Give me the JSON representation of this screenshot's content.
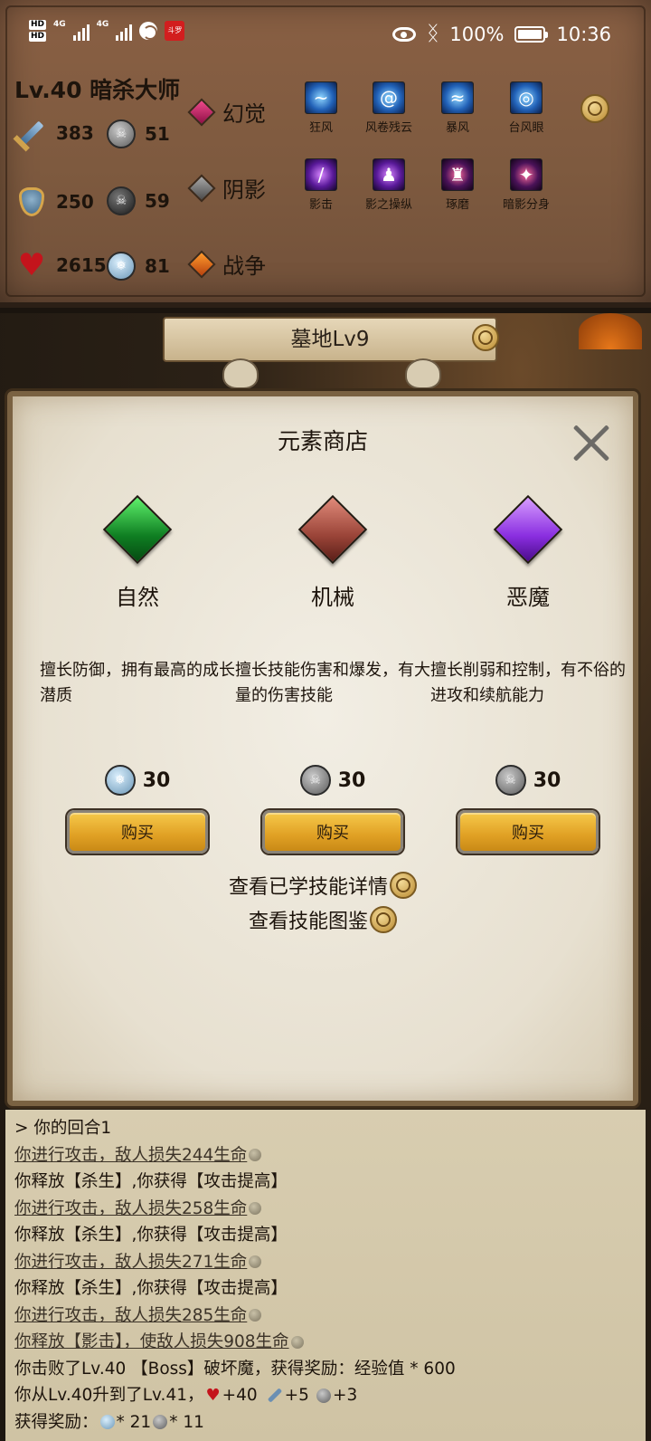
{
  "status_bar": {
    "hd1": "HD",
    "hd2": "HD",
    "net1": "4G",
    "net2": "4G",
    "app_badge": "斗罗",
    "battery": "100%",
    "time": "10:36"
  },
  "hero": {
    "title": "Lv.40 暗杀大师",
    "stats": {
      "attack": "383",
      "attack_sub": "51",
      "defense": "250",
      "defense_sub": "59",
      "hp": "2615",
      "hp_sub": "81"
    },
    "elements": [
      {
        "label": "幻觉",
        "color": "#d0206a"
      },
      {
        "label": "阴影",
        "color": "#7a7a7a"
      },
      {
        "label": "战争",
        "color": "#e06a14"
      }
    ],
    "skills_row1": [
      "狂风",
      "风卷残云",
      "暴风",
      "台风眼"
    ],
    "skills_row2": [
      "影击",
      "影之操纵",
      "琢磨",
      "暗影分身"
    ]
  },
  "scene": {
    "location": "墓地Lv9"
  },
  "shop": {
    "title": "元素商店",
    "items": [
      {
        "name": "自然",
        "desc": "擅长防御，拥有最高的成长潜质",
        "price": "30",
        "buy_label": "购买",
        "gem_color": "#1f9a2e"
      },
      {
        "name": "机械",
        "desc": "擅长技能伤害和爆发，有大量的伤害技能",
        "price": "30",
        "buy_label": "购买",
        "gem_color": "#9a4438"
      },
      {
        "name": "恶魔",
        "desc": "擅长削弱和控制，有不俗的进攻和续航能力",
        "price": "30",
        "buy_label": "购买",
        "gem_color": "#8a2ee0"
      }
    ],
    "link_learned": "查看已学技能详情",
    "link_catalog": "查看技能图鉴"
  },
  "log": {
    "lines": [
      "> 你的回合1",
      "你进行攻击，敌人损失244生命",
      "你释放【杀生】,你获得【攻击提高】",
      "你进行攻击，敌人损失258生命",
      "你释放【杀生】,你获得【攻击提高】",
      "你进行攻击，敌人损失271生命",
      "你释放【杀生】,你获得【攻击提高】",
      "你进行攻击，敌人损失285生命",
      "你释放【影击】，使敌人损失908生命",
      "你击败了Lv.40 【Boss】破坏魔，获得奖励：经验值 * 600"
    ],
    "levelup_prefix": "你从Lv.40升到了Lv.41，",
    "levelup_hp": "+40",
    "levelup_atk": "+5",
    "levelup_def": "+3",
    "reward_prefix": "获得奖励：",
    "reward_a": "* 21",
    "reward_b": "* 11"
  }
}
